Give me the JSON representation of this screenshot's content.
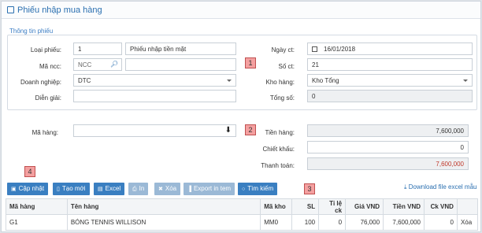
{
  "header": {
    "title": "Phiếu nhập mua hàng"
  },
  "info": {
    "section_label": "Thông tin phiếu",
    "loai_phieu_label": "Loại phiếu:",
    "loai_phieu_code": "1",
    "loai_phieu_name": "Phiếu nhập tiền mặt",
    "ma_ncc_label": "Mã ncc:",
    "ma_ncc_placeholder": "NCC",
    "ma_ncc_name": "",
    "doanh_nghiep_label": "Doanh nghiệp:",
    "doanh_nghiep_value": "DTC",
    "dien_giai_label": "Diễn giải:",
    "dien_giai_value": "",
    "ngay_ct_label": "Ngày ct:",
    "ngay_ct_value": "16/01/2018",
    "so_ct_label": "Số ct:",
    "so_ct_value": "21",
    "kho_hang_label": "Kho hàng:",
    "kho_hang_value": "Kho Tổng",
    "tong_so_label": "Tổng số:",
    "tong_so_value": "0"
  },
  "item_entry": {
    "ma_hang_label": "Mã hàng:",
    "ma_hang_value": "",
    "tien_hang_label": "Tiền hàng:",
    "tien_hang_value": "7,600,000",
    "chiet_khau_label": "Chiết khấu:",
    "chiet_khau_value": "0",
    "thanh_toan_label": "Thanh toán:",
    "thanh_toan_value": "7,600,000",
    "thanh_toan_color": "#c0392b"
  },
  "annotations": [
    "1",
    "2",
    "3",
    "4"
  ],
  "toolbar": {
    "save": "Cập nhật",
    "new": "Tạo mới",
    "excel": "Excel",
    "print": "In",
    "delete": "Xóa",
    "export_tem": "Export in tem",
    "search": "Tìm kiếm",
    "download_link": "Download file excel mẫu"
  },
  "table": {
    "headers": [
      "Mã hàng",
      "Tên hàng",
      "Mã kho",
      "SL",
      "Tỉ lệ ck",
      "Giá VND",
      "Tiền VND",
      "Ck VND",
      ""
    ],
    "rows": [
      [
        "G1",
        "BÓNG TENNIS WILLISON",
        "MM0",
        "100",
        "0",
        "76,000",
        "7,600,000",
        "0",
        "Xóa"
      ]
    ]
  },
  "colors": {
    "accent": "#3a7fc1",
    "annotation": "#f4a0a0"
  }
}
